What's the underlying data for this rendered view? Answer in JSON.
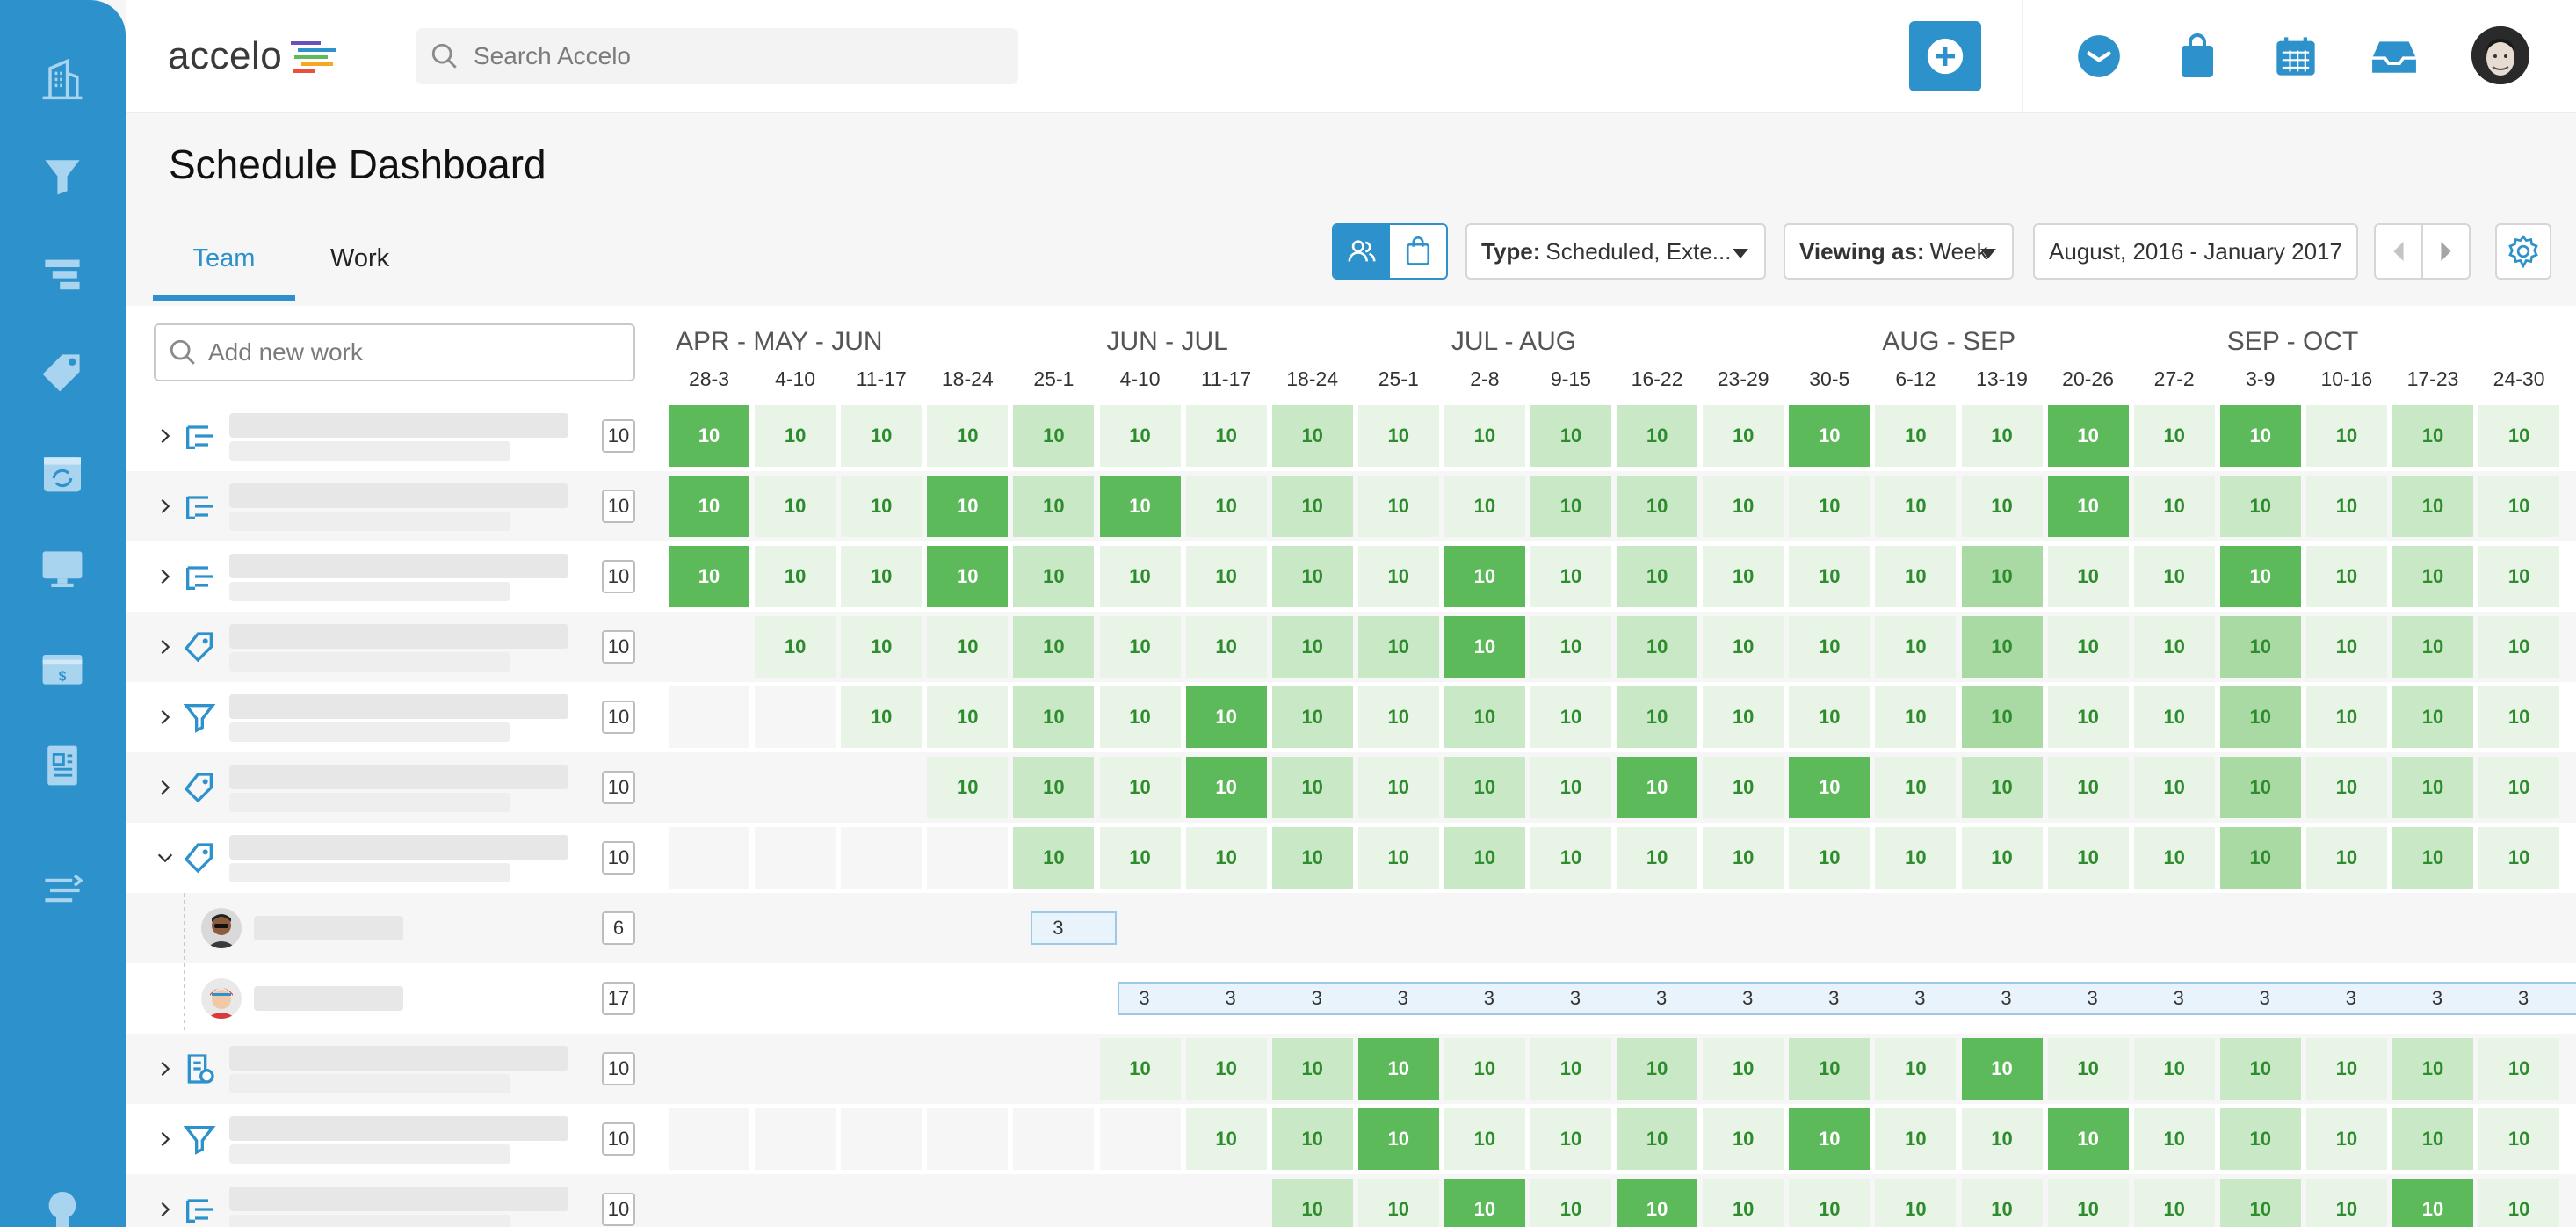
{
  "app": {
    "logo_text": "accelo"
  },
  "header": {
    "search_placeholder": "Search Accelo"
  },
  "page": {
    "title": "Schedule Dashboard"
  },
  "tabs": [
    {
      "label": "Team",
      "active": true
    },
    {
      "label": "Work",
      "active": false
    }
  ],
  "toolbar": {
    "type_label": "Type:",
    "type_value": "Scheduled, Exte...",
    "viewing_label": "Viewing as:",
    "viewing_value": "Week",
    "date_range": "August, 2016 - January 2017"
  },
  "left_panel": {
    "add_work_placeholder": "Add new work"
  },
  "schedule": {
    "months": [
      "APR - MAY - JUN",
      "JUN - JUL",
      "JUL - AUG",
      "AUG - SEP",
      "SEP - OCT"
    ],
    "month_start_col": [
      0,
      5,
      9,
      14,
      18
    ],
    "weeks": [
      "28-3",
      "4-10",
      "11-17",
      "18-24",
      "25-1",
      "4-10",
      "11-17",
      "18-24",
      "25-1",
      "2-8",
      "9-15",
      "16-22",
      "23-29",
      "30-5",
      "6-12",
      "13-19",
      "20-26",
      "27-2",
      "3-9",
      "10-16",
      "17-23",
      "24-30"
    ],
    "rows": [
      {
        "kind": "work",
        "icon": "milestone-icon",
        "count": "10",
        "expanded": false,
        "start": 0,
        "value": "10",
        "levels": [
          3,
          0,
          0,
          0,
          1,
          0,
          0,
          1,
          0,
          0,
          1,
          1,
          0,
          3,
          0,
          0,
          3,
          0,
          3,
          0,
          1,
          0
        ]
      },
      {
        "kind": "work",
        "icon": "milestone-icon",
        "count": "10",
        "expanded": false,
        "start": 0,
        "value": "10",
        "levels": [
          3,
          0,
          0,
          3,
          1,
          3,
          0,
          1,
          0,
          0,
          1,
          1,
          0,
          0,
          0,
          0,
          3,
          0,
          1,
          0,
          1,
          0
        ]
      },
      {
        "kind": "work",
        "icon": "milestone-icon",
        "count": "10",
        "expanded": false,
        "start": 0,
        "value": "10",
        "levels": [
          3,
          0,
          0,
          3,
          1,
          0,
          0,
          1,
          0,
          3,
          0,
          1,
          0,
          0,
          0,
          2,
          0,
          0,
          3,
          0,
          1,
          0
        ]
      },
      {
        "kind": "work",
        "icon": "tag-icon",
        "count": "10",
        "expanded": false,
        "start": 1,
        "value": "10",
        "levels": [
          0,
          0,
          0,
          0,
          1,
          0,
          0,
          1,
          1,
          3,
          0,
          1,
          0,
          0,
          0,
          2,
          0,
          0,
          2,
          0,
          1,
          0
        ]
      },
      {
        "kind": "work",
        "icon": "funnel-icon",
        "count": "10",
        "expanded": false,
        "start": 2,
        "value": "10",
        "levels": [
          0,
          0,
          0,
          0,
          1,
          0,
          3,
          1,
          0,
          1,
          0,
          1,
          0,
          0,
          0,
          2,
          0,
          0,
          2,
          0,
          1,
          0
        ]
      },
      {
        "kind": "work",
        "icon": "tag-icon",
        "count": "10",
        "expanded": false,
        "start": 3,
        "value": "10",
        "levels": [
          0,
          0,
          0,
          0,
          1,
          0,
          3,
          1,
          0,
          1,
          0,
          3,
          0,
          3,
          0,
          1,
          0,
          0,
          2,
          0,
          1,
          0
        ]
      },
      {
        "kind": "work",
        "icon": "tag-icon",
        "count": "10",
        "expanded": true,
        "start": 4,
        "value": "10",
        "levels": [
          0,
          0,
          0,
          0,
          1,
          0,
          0,
          1,
          0,
          1,
          0,
          0,
          0,
          0,
          0,
          0,
          0,
          0,
          2,
          0,
          1,
          0
        ]
      },
      {
        "kind": "person",
        "avatar": "person-1",
        "count": "6",
        "booking_start": 4,
        "booking_end": 4,
        "booking_value": "3"
      },
      {
        "kind": "person",
        "avatar": "person-2",
        "count": "17",
        "booking_start": 5,
        "booking_end": 21,
        "booking_value": "3"
      },
      {
        "kind": "work",
        "icon": "report-icon",
        "count": "10",
        "expanded": false,
        "start": 5,
        "value": "10",
        "levels": [
          0,
          0,
          0,
          0,
          0,
          0,
          0,
          1,
          3,
          0,
          0,
          1,
          0,
          1,
          0,
          3,
          0,
          0,
          1,
          0,
          1,
          0
        ]
      },
      {
        "kind": "work",
        "icon": "funnel-icon",
        "count": "10",
        "expanded": false,
        "start": 6,
        "value": "10",
        "levels": [
          0,
          0,
          0,
          0,
          0,
          0,
          0,
          1,
          3,
          0,
          0,
          1,
          0,
          3,
          0,
          0,
          3,
          0,
          1,
          0,
          1,
          0
        ]
      },
      {
        "kind": "work",
        "icon": "milestone-icon",
        "count": "10",
        "expanded": false,
        "start": 7,
        "value": "10",
        "levels": [
          0,
          0,
          0,
          0,
          0,
          0,
          0,
          1,
          0,
          3,
          0,
          3,
          0,
          0,
          0,
          0,
          0,
          0,
          1,
          0,
          3,
          0
        ]
      }
    ]
  },
  "colors": {
    "brand": "#2d91cc",
    "level_0": "#e8f5e6",
    "level_1": "#c9e8c5",
    "level_2": "#a9daa4",
    "level_3": "#5cba5a",
    "text_green": "#2e8b2e"
  }
}
